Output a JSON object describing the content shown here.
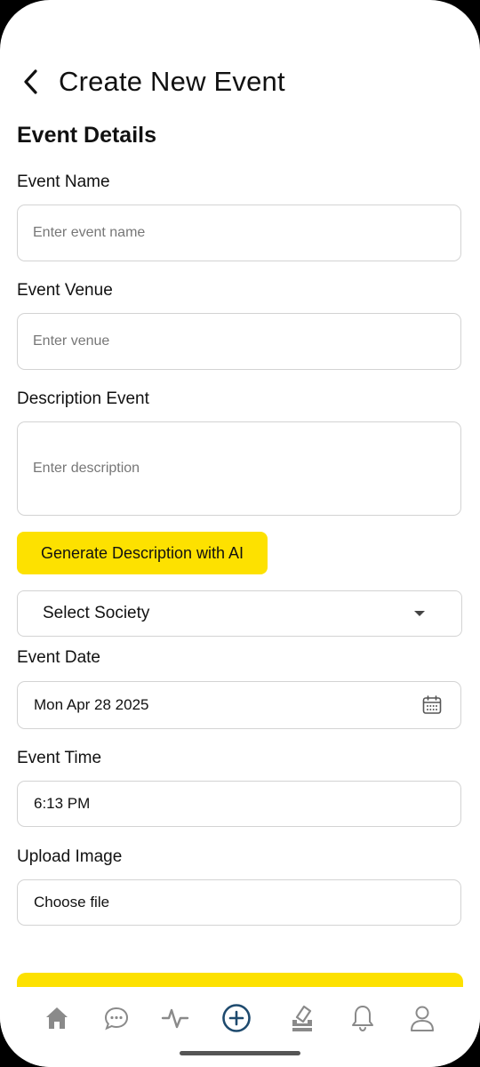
{
  "header": {
    "title": "Create New Event"
  },
  "section_title": "Event Details",
  "form": {
    "event_name": {
      "label": "Event Name",
      "placeholder": "Enter event name"
    },
    "event_venue": {
      "label": "Event Venue",
      "placeholder": "Enter venue"
    },
    "description": {
      "label": "Description Event",
      "placeholder": "Enter description"
    },
    "ai_button": "Generate Description with AI",
    "society_select": {
      "value": "Select Society"
    },
    "event_date": {
      "label": "Event Date",
      "value": "Mon Apr 28 2025"
    },
    "event_time": {
      "label": "Event Time",
      "value": "6:13 PM"
    },
    "upload_image": {
      "label": "Upload Image",
      "value": "Choose file"
    }
  },
  "nav": {
    "items": [
      {
        "icon": "home-icon"
      },
      {
        "icon": "chat-icon"
      },
      {
        "icon": "activity-icon"
      },
      {
        "icon": "add-circle-icon",
        "active": true
      },
      {
        "icon": "vote-icon"
      },
      {
        "icon": "bell-icon"
      },
      {
        "icon": "profile-icon"
      }
    ]
  },
  "colors": {
    "accent": "#FDE100",
    "nav_active": "#1E4A6E",
    "nav_inactive": "#8A8A8A"
  }
}
